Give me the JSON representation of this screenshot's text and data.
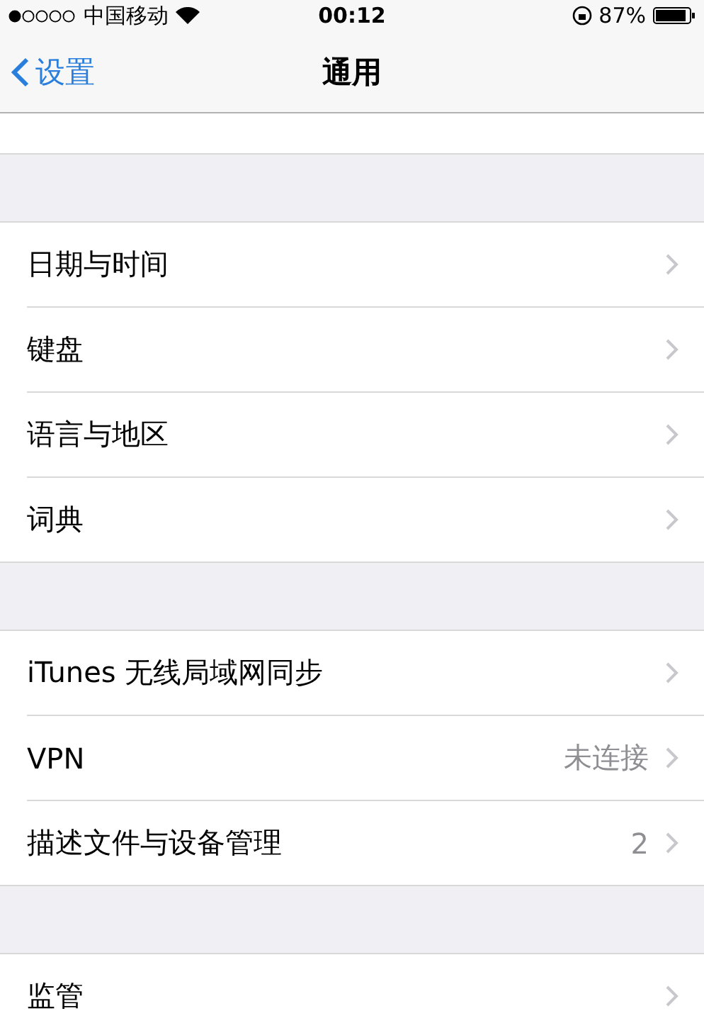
{
  "status_bar": {
    "carrier": "中国移动",
    "time": "00:12",
    "battery": "87%"
  },
  "nav_bar": {
    "back": "设置",
    "title": "通用"
  },
  "groups": [
    {
      "rows": [
        {
          "label": "日期与时间"
        },
        {
          "label": "键盘"
        },
        {
          "label": "语言与地区"
        },
        {
          "label": "词典"
        }
      ]
    },
    {
      "rows": [
        {
          "label": "iTunes 无线局域网同步"
        },
        {
          "label": "VPN",
          "value": "未连接"
        },
        {
          "label": "描述文件与设备管理",
          "value": "2"
        }
      ]
    },
    {
      "rows": [
        {
          "label": "监管"
        }
      ]
    }
  ]
}
